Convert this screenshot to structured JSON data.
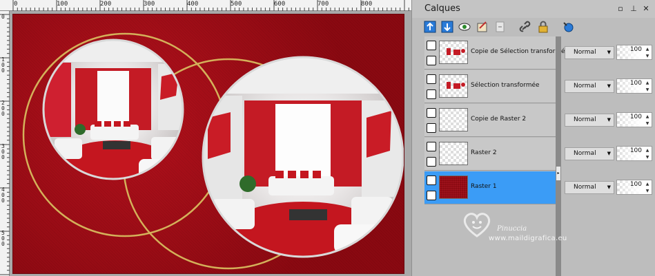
{
  "ruler": {
    "top_ticks": [
      "0",
      "100",
      "200",
      "300",
      "400",
      "500",
      "600",
      "700",
      "800"
    ],
    "left_ticks": [
      "0",
      "100",
      "200",
      "300",
      "400",
      "500"
    ]
  },
  "panel": {
    "title": "Calques",
    "title_buttons": [
      "restore-icon",
      "pin-icon",
      "close-icon"
    ],
    "toolbar_icons": [
      "new-layer-icon",
      "delete-layer-icon",
      "eye-icon",
      "properties-icon",
      "merge-icon",
      "link-icon",
      "lock-icon",
      "mask-icon"
    ],
    "layers": [
      {
        "name": "Copie de Sélection transformée",
        "blend": "Normal",
        "opacity": "100",
        "thumb": "checker-figure",
        "selected": false
      },
      {
        "name": "Sélection transformée",
        "blend": "Normal",
        "opacity": "100",
        "thumb": "checker-figure",
        "selected": false
      },
      {
        "name": "Copie de Raster 2",
        "blend": "Normal",
        "opacity": "100",
        "thumb": "checker",
        "selected": false
      },
      {
        "name": "Raster 2",
        "blend": "Normal",
        "opacity": "100",
        "thumb": "checker",
        "selected": false
      },
      {
        "name": "Raster 1",
        "blend": "Normal",
        "opacity": "100",
        "thumb": "red",
        "selected": true
      }
    ]
  },
  "watermark": {
    "line1": "Pinuccia",
    "line2": "www.maildigrafica.eu"
  },
  "colors": {
    "canvas_red": "#9c0b14",
    "gold_ring": "#d4b15a",
    "selected_layer": "#3b9cf6"
  }
}
